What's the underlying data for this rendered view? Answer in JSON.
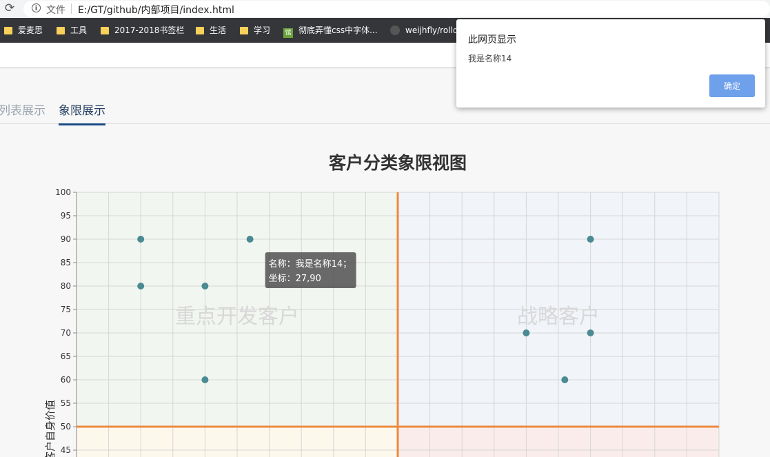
{
  "browser": {
    "file_label": "文件",
    "url": "E:/GT/github/内部项目/index.html",
    "bookmarks": [
      "爱麦思",
      "工具",
      "2017-2018书签栏",
      "生活",
      "学习",
      "彻底弄懂css中字体...",
      "weijhfly/rolld"
    ],
    "bookmark_icon_text": "馆"
  },
  "tabs": {
    "list": "列表展示",
    "quadrant": "象限展示"
  },
  "dialog": {
    "title": "此网页显示",
    "message": "我是名称14",
    "ok": "确定"
  },
  "chart_data": {
    "type": "scatter",
    "title": "客户分类象限视图",
    "ylabel": "客户自身价值",
    "ylim": [
      45,
      100
    ],
    "yticks": [
      100,
      95,
      90,
      85,
      80,
      75,
      70,
      65,
      60,
      55,
      50,
      45
    ],
    "x_split": 50,
    "y_split": 50,
    "quadrant_labels": {
      "top_left": "重点开发客户",
      "top_right": "战略客户"
    },
    "points": [
      {
        "x": 10,
        "y": 90
      },
      {
        "x": 27,
        "y": 90
      },
      {
        "x": 10,
        "y": 80
      },
      {
        "x": 20,
        "y": 80
      },
      {
        "x": 20,
        "y": 60
      },
      {
        "x": 80,
        "y": 90
      },
      {
        "x": 70,
        "y": 70
      },
      {
        "x": 80,
        "y": 70
      },
      {
        "x": 76,
        "y": 60
      }
    ],
    "tooltip": {
      "line1": "名称：我是名称14；",
      "line2": "坐标：27,90"
    },
    "colors": {
      "point": "#4a8a92",
      "divider": "#ec8a3f",
      "q_tl": "#f2f6f0",
      "q_tr": "#f1f4f9",
      "q_bl": "#fdf8ec",
      "q_br": "#fbecec"
    }
  }
}
